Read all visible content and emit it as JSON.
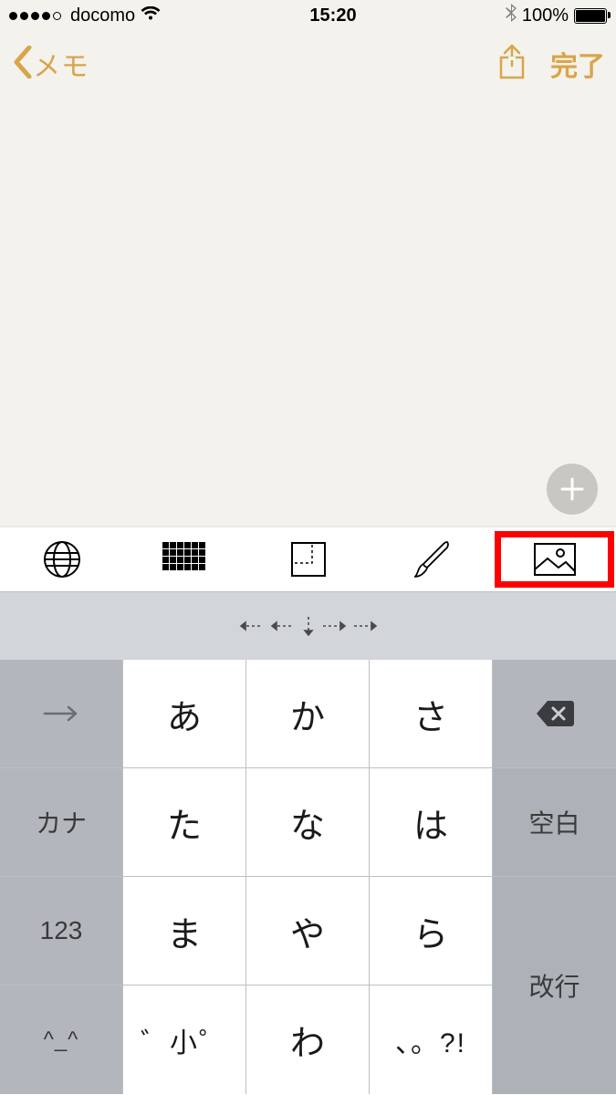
{
  "status": {
    "signal_filled": 4,
    "signal_total": 5,
    "carrier": "docomo",
    "time": "15:20",
    "battery_pct": "100%"
  },
  "nav": {
    "back_label": "メモ",
    "done_label": "完了"
  },
  "keyboard": {
    "cursor_hint": "cursor",
    "keys": {
      "arrow": "→",
      "a": "あ",
      "ka": "か",
      "sa": "さ",
      "kana": "カナ",
      "ta": "た",
      "na": "な",
      "ha": "は",
      "space": "空白",
      "num": "123",
      "ma": "ま",
      "ya": "や",
      "ra": "ら",
      "return": "改行",
      "face": "^_^",
      "dakuten": "゛小゜",
      "wa": "わ",
      "punct": "、。?!",
      "delete": "⌫"
    }
  },
  "toolbar_icons": [
    "globe",
    "grid",
    "fold",
    "brush",
    "picture"
  ]
}
